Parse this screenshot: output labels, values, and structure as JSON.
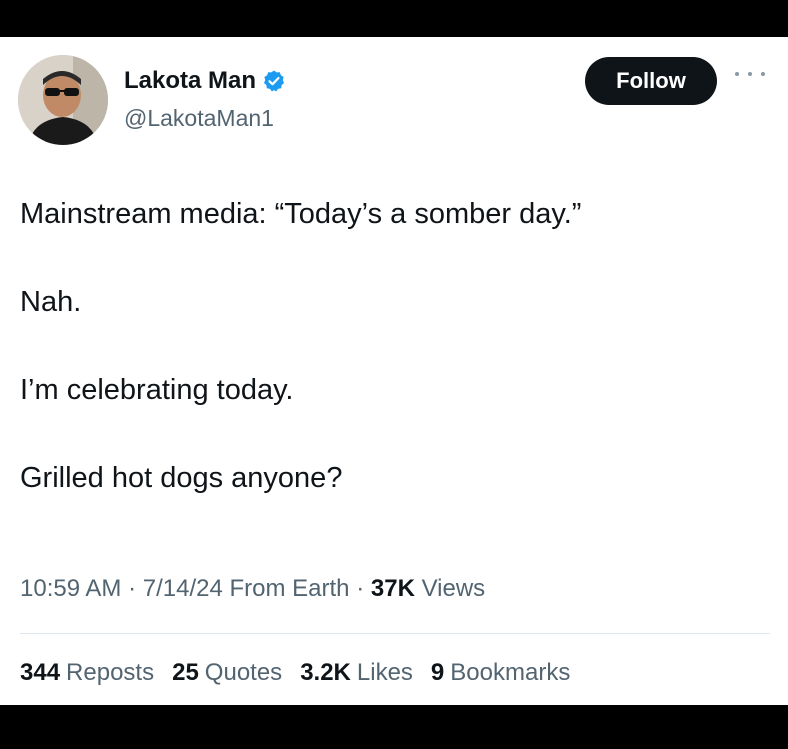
{
  "author": {
    "display_name": "Lakota Man",
    "handle": "@LakotaMan1",
    "verified_icon": "verified-badge-icon",
    "verified_color": "#1d9bf0"
  },
  "actions": {
    "follow_label": "Follow",
    "more_icon": "more-options-icon"
  },
  "tweet": {
    "paragraphs": [
      "Mainstream media: “Today’s a somber day.”",
      "Nah.",
      "I’m celebrating today.",
      "Grilled hot dogs anyone?"
    ],
    "time": "10:59 AM",
    "date": "7/14/24",
    "source": "From Earth",
    "views_count": "37K",
    "views_label": "Views"
  },
  "stats": [
    {
      "count": "344",
      "label": "Reposts"
    },
    {
      "count": "25",
      "label": "Quotes"
    },
    {
      "count": "3.2K",
      "label": "Likes"
    },
    {
      "count": "9",
      "label": "Bookmarks"
    }
  ]
}
